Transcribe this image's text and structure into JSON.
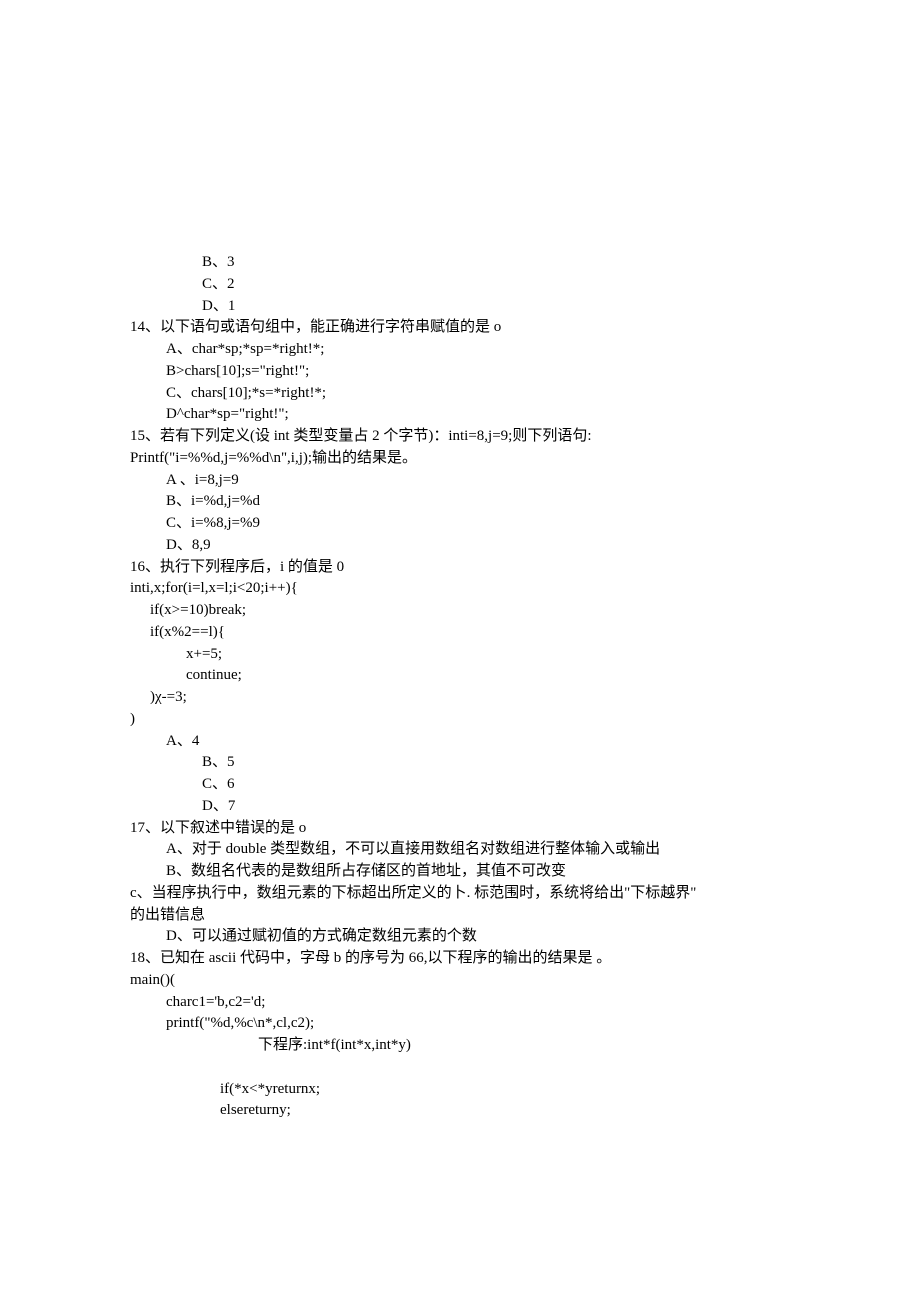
{
  "lines": [
    {
      "cls": "ind1",
      "t": "B、3"
    },
    {
      "cls": "ind1",
      "t": "C、2"
    },
    {
      "cls": "ind1",
      "t": "D、1"
    },
    {
      "cls": "",
      "t": "14、以下语句或语句组中，能正确进行字符串赋值的是 o"
    },
    {
      "cls": "ind2",
      "t": "A、char*sp;*sp=*right!*;"
    },
    {
      "cls": "ind2",
      "t": "B>chars[10];s=\"right!\";"
    },
    {
      "cls": "ind2",
      "t": "C、chars[10];*s=*right!*;"
    },
    {
      "cls": "ind2",
      "t": "D^char*sp=\"right!\";"
    },
    {
      "cls": "",
      "t": "15、若有下列定义(设 int 类型变量占 2 个字节)：inti=8,j=9;则下列语句:"
    },
    {
      "cls": "",
      "t": "Printf(\"i=%%d,j=%%d\\n\",i,j);输出的结果是。"
    },
    {
      "cls": "ind2",
      "t": "A 、i=8,j=9"
    },
    {
      "cls": "ind2",
      "t": "B、i=%d,j=%d"
    },
    {
      "cls": "ind2",
      "t": "C、i=%8,j=%9"
    },
    {
      "cls": "ind2",
      "t": "D、8,9"
    },
    {
      "cls": "",
      "t": "16、执行下列程序后，i 的值是 0"
    },
    {
      "cls": "",
      "t": "inti,x;for(i=l,x=l;i<20;i++){"
    },
    {
      "cls": "ind3",
      "t": "if(x>=10)break;"
    },
    {
      "cls": "ind3",
      "t": "if(x%2==l){"
    },
    {
      "cls": "ind5",
      "t": "x+=5;"
    },
    {
      "cls": "ind5",
      "t": "continue;"
    },
    {
      "cls": "ind3",
      "t": ")χ-=3;"
    },
    {
      "cls": "",
      "t": ")"
    },
    {
      "cls": "ind2",
      "t": "A、4"
    },
    {
      "cls": "ind1",
      "t": "B、5"
    },
    {
      "cls": "ind1",
      "t": "C、6"
    },
    {
      "cls": "ind1",
      "t": "D、7"
    },
    {
      "cls": "",
      "t": "17、以下叙述中错误的是 o"
    },
    {
      "cls": "ind2",
      "t": "A、对于 double 类型数组，不可以直接用数组名对数组进行整体输入或输出"
    },
    {
      "cls": "ind2",
      "t": "B、数组名代表的是数组所占存储区的首地址，其值不可改变"
    },
    {
      "cls": "",
      "t": "  c、当程序执行中，数组元素的下标超出所定义的卜. 标范围时，系统将给出\"下标越界\""
    },
    {
      "cls": "",
      "t": "的出错信息"
    },
    {
      "cls": "ind2",
      "t": "D、可以通过赋初值的方式确定数组元素的个数"
    },
    {
      "cls": "",
      "t": "18、已知在 ascii 代码中，字母 b 的序号为 66,以下程序的输出的结果是               。"
    },
    {
      "cls": "",
      "t": "main()("
    },
    {
      "cls": "ind2",
      "t": "charc1='b,c2='d;"
    },
    {
      "cls": "ind2",
      "t": "printf(\"%d,%c\\n*,cl,c2);"
    },
    {
      "cls": "ind6",
      "t": "下程序:int*f(int*x,int*y)"
    },
    {
      "cls": "",
      "t": " "
    },
    {
      "cls": "ind4",
      "t": "if(*x<*yreturnx;"
    },
    {
      "cls": "ind4",
      "t": "elsereturny;"
    }
  ]
}
